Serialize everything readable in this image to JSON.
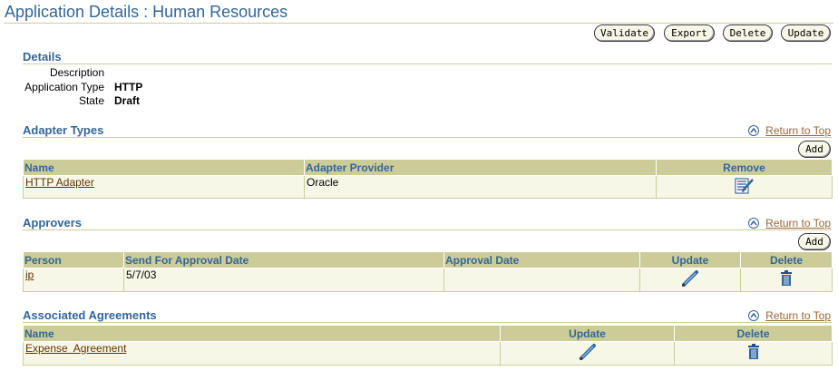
{
  "page": {
    "title": "Application Details : Human Resources"
  },
  "toolbar": {
    "validate_label": "Validate",
    "export_label": "Export",
    "delete_label": "Delete",
    "update_label": "Update"
  },
  "details": {
    "heading": "Details",
    "description_label": "Description",
    "description_value": "",
    "type_label": "Application Type",
    "type_value": "HTTP",
    "state_label": "State",
    "state_value": "Draft"
  },
  "common": {
    "return_to_top": "Return to Top",
    "add_label": "Add"
  },
  "adapter_types": {
    "heading": "Adapter Types",
    "columns": [
      "Name",
      "Adapter Provider",
      "Remove"
    ],
    "rows": [
      {
        "name": "HTTP Adapter",
        "provider": "Oracle",
        "remove_icon": "remove-icon"
      }
    ]
  },
  "approvers": {
    "heading": "Approvers",
    "columns": [
      "Person",
      "Send For Approval Date",
      "Approval Date",
      "Update",
      "Delete"
    ],
    "rows": [
      {
        "person": "ip",
        "send_date": "5/7/03",
        "approval_date": "",
        "update_icon": "pencil-icon",
        "delete_icon": "trash-icon"
      }
    ]
  },
  "agreements": {
    "heading": "Associated Agreements",
    "columns": [
      "Name",
      "Update",
      "Delete"
    ],
    "rows": [
      {
        "name": "Expense  Agreement",
        "update_icon": "pencil-icon",
        "delete_icon": "trash-icon"
      }
    ]
  },
  "colors": {
    "accent": "#336699",
    "header_bg": "#cccc99",
    "row_bg": "#f7f7e7",
    "link": "#663300",
    "return_link": "#996633"
  }
}
